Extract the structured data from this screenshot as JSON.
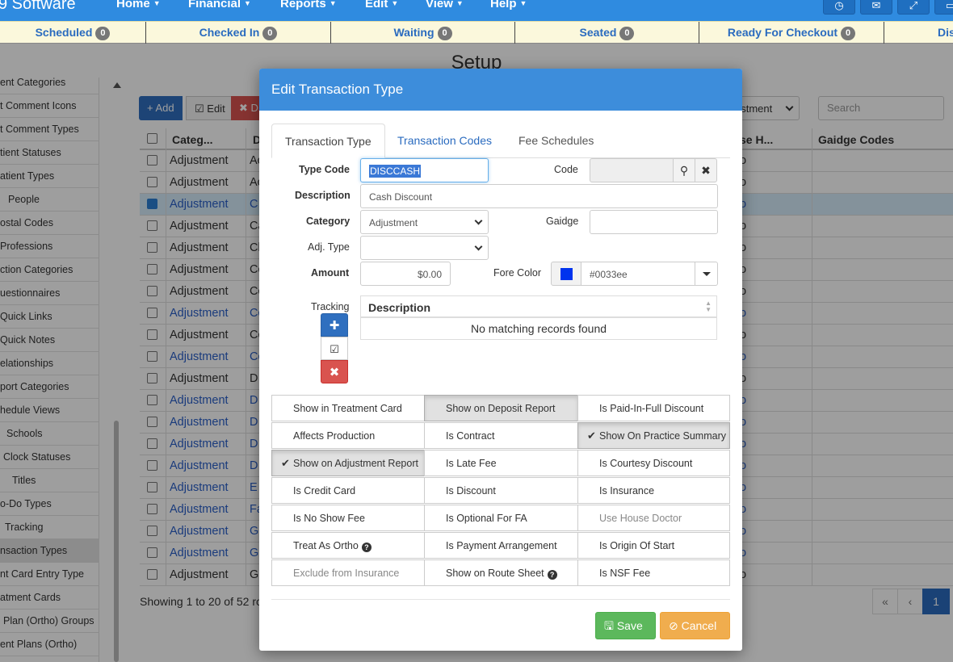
{
  "navbar": {
    "brand": "9 Software",
    "items": [
      {
        "label": "Home"
      },
      {
        "label": "Financial"
      },
      {
        "label": "Reports"
      },
      {
        "label": "Edit"
      },
      {
        "label": "View"
      },
      {
        "label": "Help"
      }
    ]
  },
  "statusbar": [
    {
      "label": "Scheduled",
      "count": "0"
    },
    {
      "label": "Checked In",
      "count": "0"
    },
    {
      "label": "Waiting",
      "count": "0"
    },
    {
      "label": "Seated",
      "count": "0"
    },
    {
      "label": "Ready For Checkout",
      "count": "0"
    },
    {
      "label": "Dis"
    }
  ],
  "page": {
    "title": "Setup",
    "sidebar": [
      "ent Categories",
      "t Comment Icons",
      "t Comment Types",
      "tient Statuses",
      "atient Types",
      "People",
      "ostal Codes",
      "Professions",
      "ction Categories",
      "uestionnaires",
      "Quick Links",
      "Quick Notes",
      "elationships",
      "port Categories",
      "hedule Views",
      "Schools",
      "Clock Statuses",
      "Titles",
      "o-Do Types",
      "Tracking",
      "nsaction Types",
      "nt Card Entry Type",
      "atment Cards",
      "Plan (Ortho) Groups",
      "ent Plans (Ortho)"
    ],
    "toolbar": {
      "add": "+ Add",
      "edit": "Edit",
      "delete": "D"
    },
    "filter_value": "ustment",
    "search_placeholder": "Search",
    "grid_headers": {
      "category": "Categ...",
      "desc": "D",
      "house": "se H...",
      "gaidge": "Gaidge Codes"
    },
    "grid_rows": [
      {
        "cat": "Adjustment",
        "d": "Ac",
        "h": "o"
      },
      {
        "cat": "Adjustment",
        "d": "Ac",
        "h": "o"
      },
      {
        "cat": "Adjustment",
        "d": "C",
        "h": "o"
      },
      {
        "cat": "Adjustment",
        "d": "Ca",
        "h": "o"
      },
      {
        "cat": "Adjustment",
        "d": "Ch",
        "h": "o"
      },
      {
        "cat": "Adjustment",
        "d": "Co",
        "h": "o"
      },
      {
        "cat": "Adjustment",
        "d": "Co",
        "h": "o"
      },
      {
        "cat": "Adjustment",
        "d": "Co",
        "h": "o"
      },
      {
        "cat": "Adjustment",
        "d": "Co",
        "h": "o"
      },
      {
        "cat": "Adjustment",
        "d": "Co",
        "h": "o"
      },
      {
        "cat": "Adjustment",
        "d": "D",
        "h": "o"
      },
      {
        "cat": "Adjustment",
        "d": "D",
        "h": "o"
      },
      {
        "cat": "Adjustment",
        "d": "D",
        "h": "o"
      },
      {
        "cat": "Adjustment",
        "d": "D",
        "h": "o"
      },
      {
        "cat": "Adjustment",
        "d": "D",
        "h": "o"
      },
      {
        "cat": "Adjustment",
        "d": "E",
        "h": "o"
      },
      {
        "cat": "Adjustment",
        "d": "Fa",
        "h": "o"
      },
      {
        "cat": "Adjustment",
        "d": "G",
        "h": "o"
      },
      {
        "cat": "Adjustment",
        "d": "G",
        "h": "o"
      },
      {
        "cat": "Adjustment",
        "d": "G",
        "h": "o"
      }
    ],
    "showing": "Showing 1 to 20 of 52 ro",
    "pager": {
      "first": "«",
      "prev": "‹",
      "current": "1"
    }
  },
  "modal": {
    "title": "Edit Transaction Type",
    "tabs": [
      "Transaction Type",
      "Transaction Codes",
      "Fee Schedules"
    ],
    "fields": {
      "type_code_label": "Type Code",
      "type_code": "DISCCASH",
      "code_label": "Code",
      "code": "",
      "description_label": "Description",
      "description": "Cash Discount",
      "category_label": "Category",
      "category": "Adjustment",
      "gaidge_label": "Gaidge",
      "gaidge": "",
      "adj_type_label": "Adj. Type",
      "adj_type": "",
      "amount_label": "Amount",
      "amount": "$0.00",
      "fore_color_label": "Fore Color",
      "fore_color": "#0033ee"
    },
    "tracking": {
      "label": "Tracking",
      "header": "Description",
      "empty": "No matching records found"
    },
    "options": [
      {
        "label": "Show in Treatment Card",
        "on": false
      },
      {
        "label": "Show on Deposit Report",
        "on": true
      },
      {
        "label": "Is Paid-In-Full Discount",
        "on": false
      },
      {
        "label": "Affects Production",
        "on": false
      },
      {
        "label": "Is Contract",
        "on": false
      },
      {
        "label": "Show On Practice Summary",
        "on": true
      },
      {
        "label": "Show on Adjustment Report",
        "on": true
      },
      {
        "label": "Is Late Fee",
        "on": false
      },
      {
        "label": "Is Courtesy Discount",
        "on": false
      },
      {
        "label": "Is Credit Card",
        "on": false
      },
      {
        "label": "Is Discount",
        "on": false
      },
      {
        "label": "Is Insurance",
        "on": false
      },
      {
        "label": "Is No Show Fee",
        "on": false
      },
      {
        "label": "Is Optional For FA",
        "on": false
      },
      {
        "label": "Use House Doctor",
        "on": false
      },
      {
        "label": "Treat As Ortho",
        "on": false
      },
      {
        "label": "Is Payment Arrangement",
        "on": false
      },
      {
        "label": "Is Origin Of Start",
        "on": false
      },
      {
        "label": "Exclude from Insurance",
        "on": false
      },
      {
        "label": "Show on Route Sheet",
        "on": false
      },
      {
        "label": "Is NSF Fee",
        "on": false
      }
    ],
    "save_label": "Save",
    "cancel_label": "Cancel"
  },
  "colors": {
    "navbar": "#2f8be0",
    "modal_header": "#3d8ddb",
    "save": "#5cb85c",
    "cancel": "#f0ad4e",
    "danger": "#d9534f",
    "primary": "#2f6fbf"
  }
}
